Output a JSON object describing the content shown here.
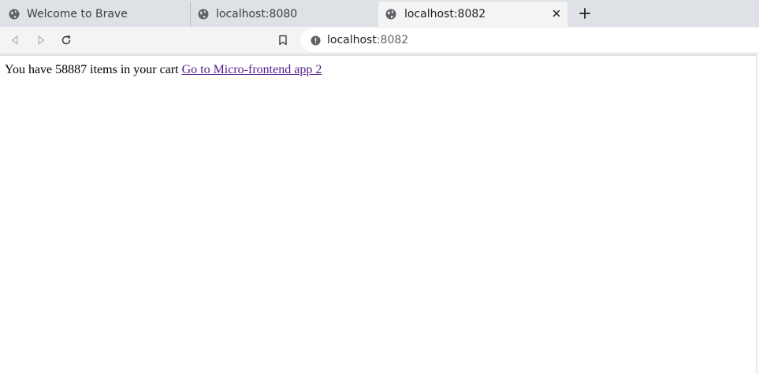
{
  "browser": {
    "tabs": [
      {
        "title": "Welcome to Brave",
        "active": false,
        "icon": "globe-icon"
      },
      {
        "title": "localhost:8080",
        "active": false,
        "icon": "globe-icon"
      },
      {
        "title": "localhost:8082",
        "active": true,
        "icon": "globe-icon"
      }
    ],
    "address": {
      "host": "localhost",
      "port": ":8082",
      "icon": "info-icon"
    },
    "colors": {
      "tabstrip": "#dee1e6",
      "toolbar": "#f4f4f4",
      "link_visited": "#551a8b"
    }
  },
  "page": {
    "cart_prefix": "You have",
    "cart_count": "58887",
    "cart_suffix": "items in your cart",
    "link_label": "Go to Micro-frontend app 2"
  }
}
